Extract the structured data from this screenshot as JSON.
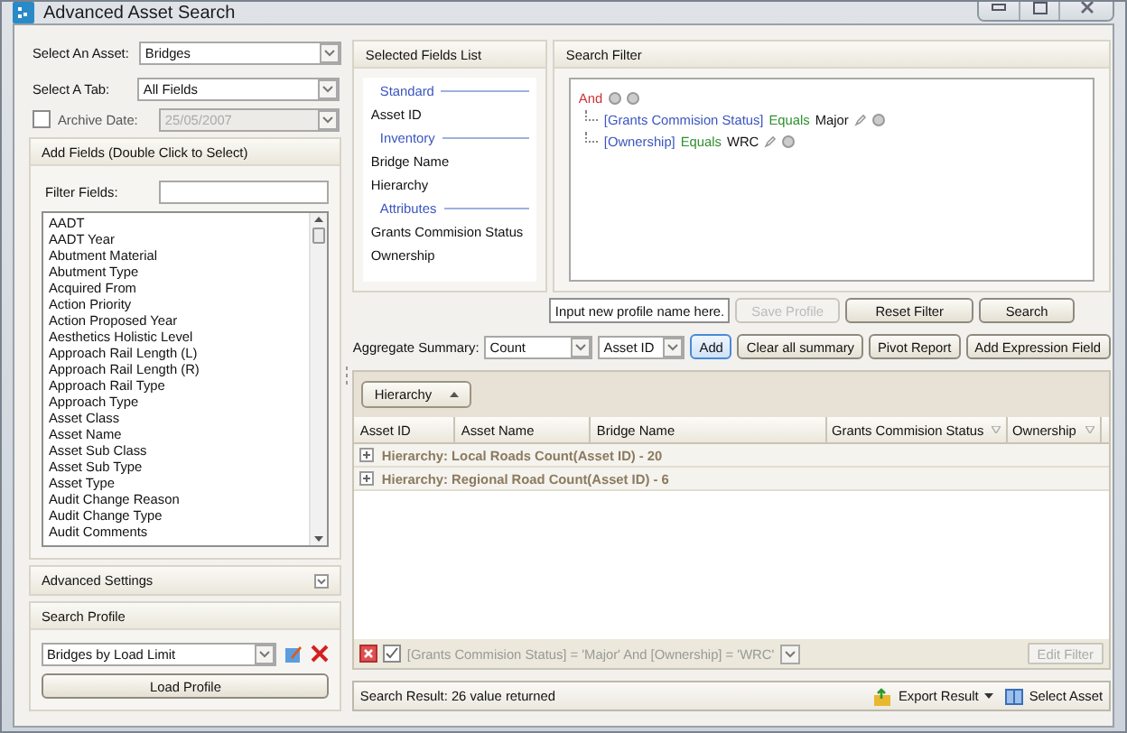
{
  "window": {
    "title": "Advanced Asset Search"
  },
  "left": {
    "asset": {
      "label": "Select An Asset:",
      "value": "Bridges"
    },
    "tab": {
      "label": "Select A Tab:",
      "value": "All Fields"
    },
    "archive": {
      "label": "Archive Date:",
      "value": "25/05/2007",
      "checked": false,
      "disabled": true
    },
    "add_fields": {
      "title": "Add Fields (Double Click to Select)",
      "filter_label": "Filter Fields:",
      "fields": [
        "AADT",
        "AADT Year",
        "Abutment Material",
        "Abutment Type",
        "Acquired From",
        "Action Priority",
        "Action Proposed Year",
        "Aesthetics Holistic Level",
        "Approach Rail Length (L)",
        "Approach Rail Length (R)",
        "Approach Rail Type",
        "Approach Type",
        "Asset Class",
        "Asset Name",
        "Asset Sub Class",
        "Asset Sub Type",
        "Asset Type",
        "Audit Change Reason",
        "Audit Change Type",
        "Audit Comments"
      ]
    },
    "advanced_settings": {
      "title": "Advanced Settings",
      "expanded": false
    },
    "search_profile": {
      "title": "Search Profile",
      "value": "Bridges by Load Limit",
      "button": "Load Profile"
    }
  },
  "selected_fields": {
    "title": "Selected Fields List",
    "groups": [
      {
        "name": "Standard",
        "fields": [
          "Asset ID"
        ]
      },
      {
        "name": "Inventory",
        "fields": [
          "Bridge Name",
          "Hierarchy"
        ]
      },
      {
        "name": "Attributes",
        "fields": [
          "Grants Commision Status",
          "Ownership"
        ]
      }
    ]
  },
  "search_filter": {
    "title": "Search Filter",
    "operator": "And",
    "conditions": [
      {
        "field": "[Grants Commision Status]",
        "op": "Equals",
        "value": "Major"
      },
      {
        "field": "[Ownership]",
        "op": "Equals",
        "value": "WRC"
      }
    ]
  },
  "profile_input": {
    "value": "Input new profile name here."
  },
  "filter_buttons": [
    {
      "label": "Save Profile",
      "disabled": true
    },
    {
      "label": "Reset Filter",
      "disabled": false
    },
    {
      "label": "Search",
      "disabled": false
    }
  ],
  "aggregate": {
    "label": "Aggregate Summary:",
    "function": "Count",
    "field": "Asset ID",
    "buttons": [
      {
        "label": "Add",
        "selected": true
      },
      {
        "label": "Clear all summary",
        "selected": false
      },
      {
        "label": "Pivot Report",
        "selected": false
      },
      {
        "label": "Add Expression Field",
        "selected": false
      }
    ]
  },
  "grid": {
    "group_by": "Hierarchy",
    "columns": [
      {
        "label": "Asset ID",
        "filterable": false
      },
      {
        "label": "Asset Name",
        "filterable": false
      },
      {
        "label": "Bridge Name",
        "filterable": false
      },
      {
        "label": "Grants Commision Status",
        "filterable": true
      },
      {
        "label": "Ownership",
        "filterable": true
      }
    ],
    "groups": [
      {
        "text": "Hierarchy: Local Roads  Count(Asset ID) - 20",
        "expanded": false
      },
      {
        "text": "Hierarchy: Regional Road  Count(Asset ID) - 6",
        "expanded": false
      }
    ],
    "filter_bar": {
      "enabled": true,
      "text": "[Grants Commision Status] = 'Major' And [Ownership] = 'WRC'",
      "button": "Edit Filter"
    }
  },
  "status_bar": {
    "text": "Search Result: 26 value returned",
    "actions": [
      {
        "label": "Export Result",
        "kind": "menu"
      },
      {
        "label": "Select Asset",
        "kind": "button"
      }
    ]
  }
}
